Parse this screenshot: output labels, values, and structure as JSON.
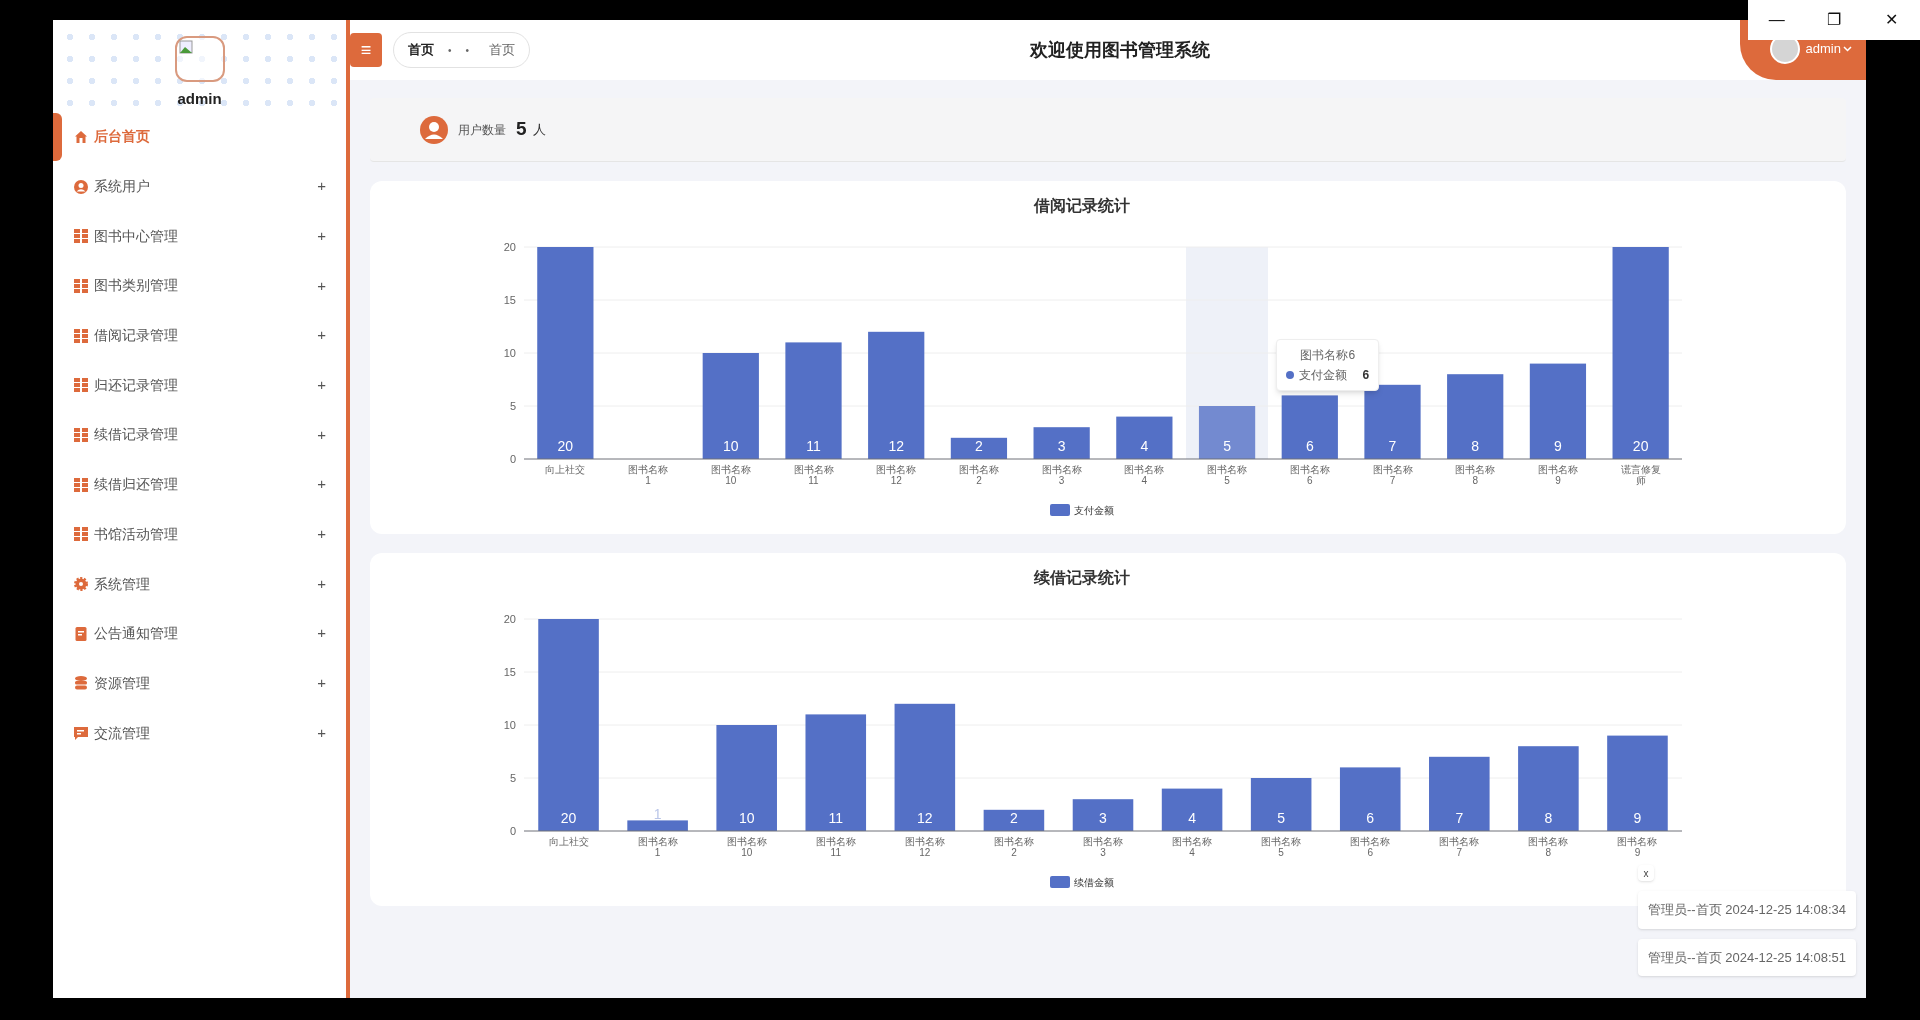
{
  "window_controls": [
    "—",
    "❐",
    "✕"
  ],
  "sidebar": {
    "user": "admin",
    "items": [
      {
        "label": "后台首页",
        "kind": "home",
        "selected": true,
        "expandable": false
      },
      {
        "label": "系统用户",
        "kind": "user",
        "selected": false,
        "expandable": true
      },
      {
        "label": "图书中心管理",
        "kind": "grid",
        "selected": false,
        "expandable": true
      },
      {
        "label": "图书类别管理",
        "kind": "grid",
        "selected": false,
        "expandable": true
      },
      {
        "label": "借阅记录管理",
        "kind": "grid",
        "selected": false,
        "expandable": true
      },
      {
        "label": "归还记录管理",
        "kind": "grid",
        "selected": false,
        "expandable": true
      },
      {
        "label": "续借记录管理",
        "kind": "grid",
        "selected": false,
        "expandable": true
      },
      {
        "label": "续借归还管理",
        "kind": "grid",
        "selected": false,
        "expandable": true
      },
      {
        "label": "书馆活动管理",
        "kind": "grid",
        "selected": false,
        "expandable": true
      },
      {
        "label": "系统管理",
        "kind": "gear",
        "selected": false,
        "expandable": true
      },
      {
        "label": "公告通知管理",
        "kind": "doc",
        "selected": false,
        "expandable": true
      },
      {
        "label": "资源管理",
        "kind": "db",
        "selected": false,
        "expandable": true
      },
      {
        "label": "交流管理",
        "kind": "chat",
        "selected": false,
        "expandable": true
      }
    ],
    "expand_symbol": "+"
  },
  "header": {
    "menu_symbol": "≡",
    "breadcrumb": [
      "首页",
      "•",
      "•",
      "首页"
    ],
    "title": "欢迎使用图书管理系统",
    "user": "admin"
  },
  "user_count": {
    "label": "用户数量",
    "value": "5",
    "unit": "人"
  },
  "charts": [
    {
      "chart_data": {
        "type": "bar",
        "title": "借阅记录统计",
        "categories": [
          "向上社交",
          "图书名称1",
          "图书名称10",
          "图书名称11",
          "图书名称12",
          "图书名称2",
          "图书名称3",
          "图书名称4",
          "图书名称5",
          "图书名称6",
          "图书名称7",
          "图书名称8",
          "图书名称9",
          "谎言修复师"
        ],
        "series": [
          {
            "name": "支付金额",
            "color": "#5470c6",
            "values": [
              20,
              null,
              10,
              11,
              12,
              2,
              3,
              4,
              5,
              6,
              7,
              8,
              9,
              20
            ]
          }
        ],
        "ylim": [
          0,
          20
        ],
        "yticks": [
          0,
          5,
          10,
          15,
          20
        ],
        "grid": true,
        "data_labels": true
      },
      "category_hover": [
        false,
        false,
        false,
        false,
        false,
        false,
        false,
        false,
        true,
        false,
        false,
        false,
        false,
        false
      ],
      "tooltip": {
        "title": "图书名称6",
        "label": "支付金额",
        "value": "6"
      }
    },
    {
      "chart_data": {
        "type": "bar",
        "title": "续借记录统计",
        "categories": [
          "向上社交",
          "图书名称1",
          "图书名称10",
          "图书名称11",
          "图书名称12",
          "图书名称2",
          "图书名称3",
          "图书名称4",
          "图书名称5",
          "图书名称6",
          "图书名称7",
          "图书名称8",
          "图书名称9"
        ],
        "series": [
          {
            "name": "续借金额",
            "color": "#5470c6",
            "values": [
              20,
              1,
              10,
              11,
              12,
              2,
              3,
              4,
              5,
              6,
              7,
              8,
              9
            ]
          }
        ],
        "ylim": [
          0,
          20
        ],
        "yticks": [
          0,
          5,
          10,
          15,
          20
        ],
        "grid": true,
        "data_labels": true
      }
    }
  ],
  "notifications": {
    "close_symbol": "x",
    "items": [
      "管理员--首页 2024-12-25 14:08:34",
      "管理员--首页 2024-12-25 14:08:51"
    ]
  }
}
